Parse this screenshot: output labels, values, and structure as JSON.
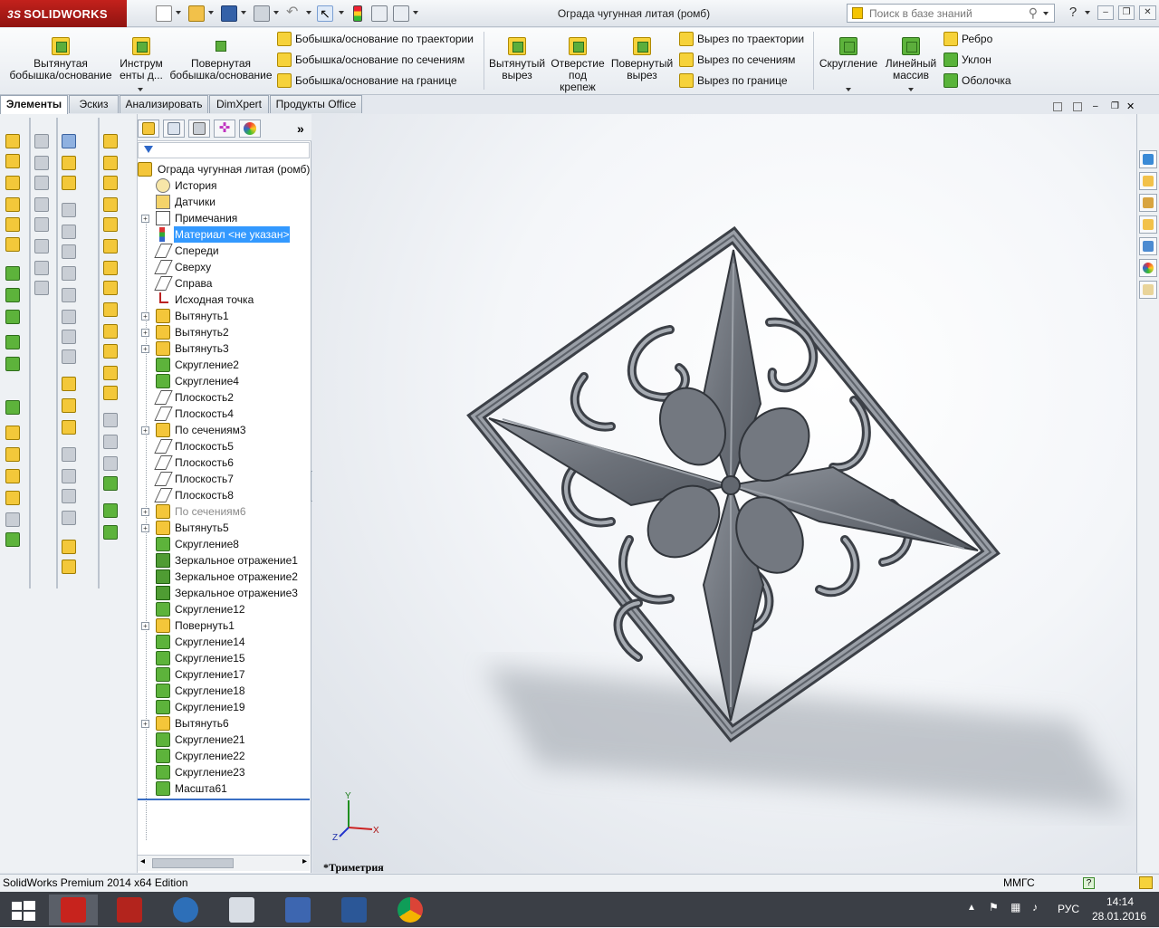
{
  "app": {
    "logo_prefix": "3S",
    "logo_text": "SOLIDWORKS",
    "document_title": "Ограда чугунная литая (ромб)",
    "search_placeholder": "Поиск в базе знаний"
  },
  "command_manager": {
    "large_buttons": [
      {
        "label": "Вытянутая\nбобышка/основание"
      },
      {
        "label": "Инструм\nенты д..."
      },
      {
        "label": "Повернутая\nбобышка/основание"
      },
      {
        "label": "Вытянутый\nвырез"
      },
      {
        "label": "Отверстие\nпод\nкрепеж"
      },
      {
        "label": "Повернутый\nвырез"
      },
      {
        "label": "Скругление"
      },
      {
        "label": "Линейный\nмассив"
      }
    ],
    "small_buttons": [
      {
        "label": "Бобышка/основание по траектории"
      },
      {
        "label": "Бобышка/основание по сечениям"
      },
      {
        "label": "Бобышка/основание на границе"
      },
      {
        "label": "Вырез по траектории"
      },
      {
        "label": "Вырез по сечениям"
      },
      {
        "label": "Вырез по границе"
      },
      {
        "label": "Ребро"
      },
      {
        "label": "Уклон"
      },
      {
        "label": "Оболочка"
      }
    ]
  },
  "tabs": [
    "Элементы",
    "Эскиз",
    "Анализировать",
    "DimXpert",
    "Продукты Office"
  ],
  "feature_tree": {
    "root": "Ограда чугунная литая (ромб)",
    "items": [
      {
        "label": "История",
        "icon": "history-icon",
        "expandable": false
      },
      {
        "label": "Датчики",
        "icon": "sensor-icon",
        "expandable": false
      },
      {
        "label": "Примечания",
        "icon": "annotation-icon",
        "expandable": true
      },
      {
        "label": "Материал <не указан>",
        "icon": "material-icon",
        "expandable": false,
        "selected": true
      },
      {
        "label": "Спереди",
        "icon": "plane-icon",
        "expandable": false
      },
      {
        "label": "Сверху",
        "icon": "plane-icon",
        "expandable": false
      },
      {
        "label": "Справа",
        "icon": "plane-icon",
        "expandable": false
      },
      {
        "label": "Исходная точка",
        "icon": "origin-icon",
        "expandable": false
      },
      {
        "label": "Вытянуть1",
        "icon": "extrude-icon",
        "expandable": true
      },
      {
        "label": "Вытянуть2",
        "icon": "extrude-icon",
        "expandable": true
      },
      {
        "label": "Вытянуть3",
        "icon": "extrude-icon",
        "expandable": true
      },
      {
        "label": "Скругление2",
        "icon": "fillet-icon",
        "expandable": false
      },
      {
        "label": "Скругление4",
        "icon": "fillet-icon",
        "expandable": false
      },
      {
        "label": "Плоскость2",
        "icon": "plane-icon",
        "expandable": false
      },
      {
        "label": "Плоскость4",
        "icon": "plane-icon",
        "expandable": false
      },
      {
        "label": "По сечениям3",
        "icon": "loft-icon",
        "expandable": true
      },
      {
        "label": "Плоскость5",
        "icon": "plane-icon",
        "expandable": false
      },
      {
        "label": "Плоскость6",
        "icon": "plane-icon",
        "expandable": false
      },
      {
        "label": "Плоскость7",
        "icon": "plane-icon",
        "expandable": false
      },
      {
        "label": "Плоскость8",
        "icon": "plane-icon",
        "expandable": false
      },
      {
        "label": "По сечениям6",
        "icon": "loft-icon",
        "expandable": true,
        "dim": true
      },
      {
        "label": "Вытянуть5",
        "icon": "extrude-icon",
        "expandable": true
      },
      {
        "label": "Скругление8",
        "icon": "fillet-icon",
        "expandable": false
      },
      {
        "label": "Зеркальное отражение1",
        "icon": "mirror-icon",
        "expandable": false
      },
      {
        "label": "Зеркальное отражение2",
        "icon": "mirror-icon",
        "expandable": false
      },
      {
        "label": "Зеркальное отражение3",
        "icon": "mirror-icon",
        "expandable": false
      },
      {
        "label": "Скругление12",
        "icon": "fillet-icon",
        "expandable": false
      },
      {
        "label": "Повернуть1",
        "icon": "revolve-icon",
        "expandable": true
      },
      {
        "label": "Скругление14",
        "icon": "fillet-icon",
        "expandable": false
      },
      {
        "label": "Скругление15",
        "icon": "fillet-icon",
        "expandable": false
      },
      {
        "label": "Скругление17",
        "icon": "fillet-icon",
        "expandable": false
      },
      {
        "label": "Скругление18",
        "icon": "fillet-icon",
        "expandable": false
      },
      {
        "label": "Скругление19",
        "icon": "fillet-icon",
        "expandable": false
      },
      {
        "label": "Вытянуть6",
        "icon": "extrude-icon",
        "expandable": true
      },
      {
        "label": "Скругление21",
        "icon": "fillet-icon",
        "expandable": false
      },
      {
        "label": "Скругление22",
        "icon": "fillet-icon",
        "expandable": false
      },
      {
        "label": "Скругление23",
        "icon": "fillet-icon",
        "expandable": false
      },
      {
        "label": "Масшта61",
        "icon": "scale-icon",
        "expandable": false
      }
    ]
  },
  "viewport": {
    "view_name": "*Триметрия",
    "axis_labels": {
      "x": "X",
      "y": "Y",
      "z": "Z"
    }
  },
  "status_bar": {
    "left": "SolidWorks Premium 2014 x64 Edition",
    "units": "ММГС"
  },
  "taskbar": {
    "language": "РУС",
    "time": "14:14",
    "date": "28.01.2016"
  },
  "colors": {
    "accent": "#3399ff",
    "model": "#6f747d"
  }
}
